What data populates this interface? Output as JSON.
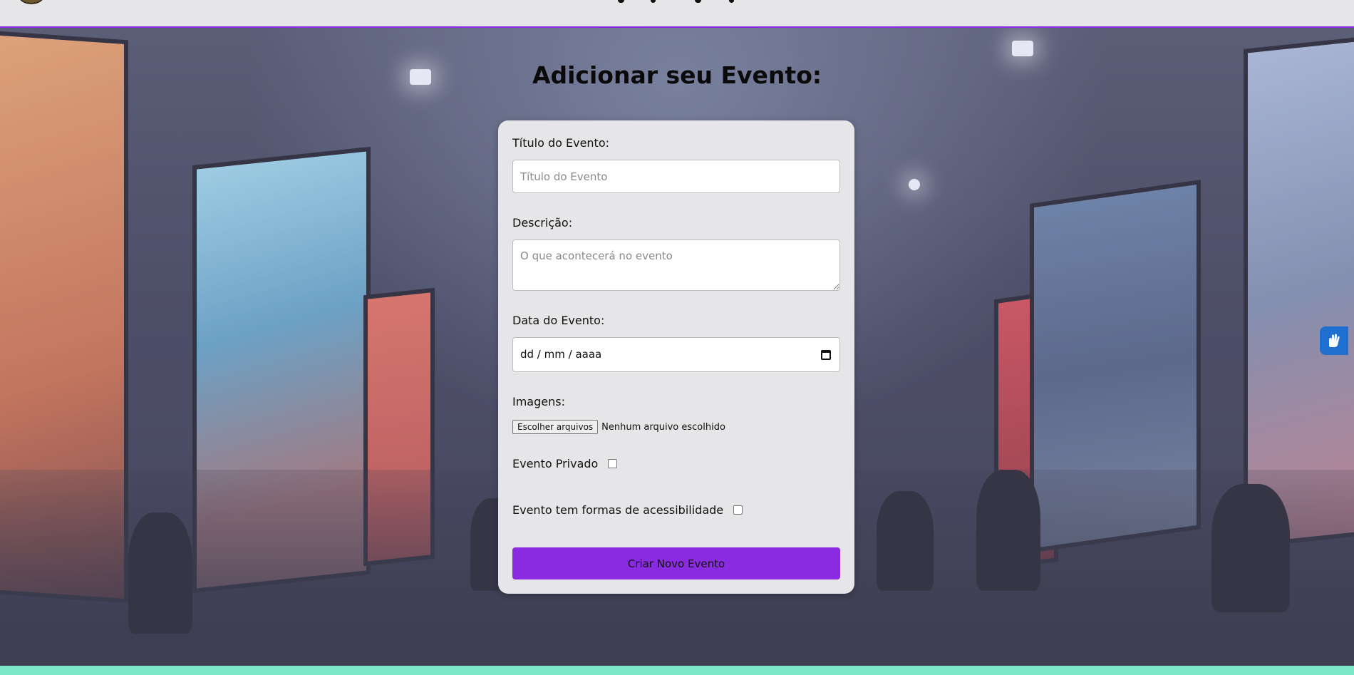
{
  "page": {
    "title": "Adicionar seu Evento:"
  },
  "form": {
    "title_label": "Título do Evento:",
    "title_placeholder": "Título do Evento",
    "description_label": "Descrição:",
    "description_placeholder": "O que acontecerá no evento",
    "date_label": "Data do Evento:",
    "date_placeholder": "dd / mm / aaaa",
    "images_label": "Imagens:",
    "file_button_label": "Escolher arquivos",
    "file_status": "Nenhum arquivo escolhido",
    "private_label": "Evento Privado",
    "accessibility_label": "Evento tem formas de acessibilidade",
    "submit_label": "Criar Novo Evento"
  },
  "icons": {
    "date_picker": "calendar-icon",
    "accessibility_widget": "sign-language-hands-icon",
    "site_logo": "logo-icon"
  },
  "colors": {
    "accent": "#8a2be2",
    "card_background": "#e6e5e7",
    "widget_blue": "#1f6fd1",
    "bottom_strip": "#7fe8c9"
  }
}
